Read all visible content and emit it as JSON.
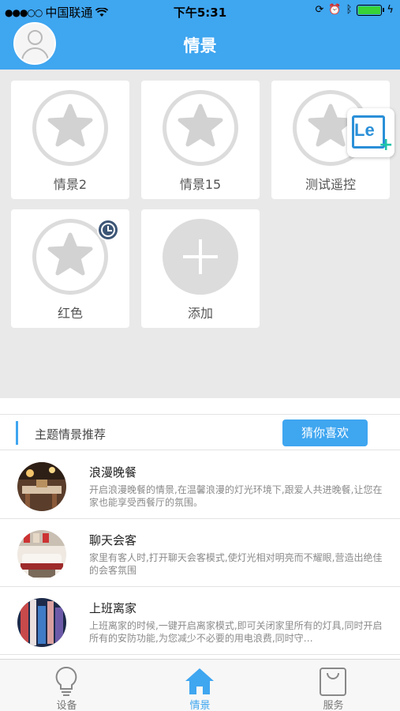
{
  "status_bar": {
    "carrier": "中国联通",
    "time": "下午5:31"
  },
  "header": {
    "title": "情景"
  },
  "scenes": [
    {
      "label": "情景2",
      "has_timer": false
    },
    {
      "label": "情景15",
      "has_timer": false
    },
    {
      "label": "测试遥控",
      "has_timer": false
    },
    {
      "label": "红色",
      "has_timer": true
    }
  ],
  "add_tile": {
    "label": "添加"
  },
  "le_badge": {
    "text": "Le",
    "plus": "+"
  },
  "recommend": {
    "title": "主题情景推荐",
    "button_label": "猜你喜欢",
    "items": [
      {
        "name": "浪漫晚餐",
        "desc": "开启浪漫晚餐的情景,在温馨浪漫的灯光环境下,跟爱人共进晚餐,让您在家也能享受西餐厅的氛围。"
      },
      {
        "name": "聊天会客",
        "desc": "家里有客人时,打开聊天会客模式,使灯光相对明亮而不耀眼,营造出绝佳的会客氛围"
      },
      {
        "name": "上班离家",
        "desc": "上班离家的时候,一键开启离家模式,即可关闭家里所有的灯具,同时开启所有的安防功能,为您减少不必要的用电浪费,同时守…"
      }
    ]
  },
  "tabs": [
    {
      "label": "设备",
      "icon": "bulb-icon",
      "active": false
    },
    {
      "label": "情景",
      "icon": "home-icon",
      "active": true
    },
    {
      "label": "服务",
      "icon": "bag-icon",
      "active": false
    }
  ],
  "colors": {
    "accent": "#3fa6f0",
    "background": "#e9e9e9",
    "badge": "#3d5676"
  }
}
